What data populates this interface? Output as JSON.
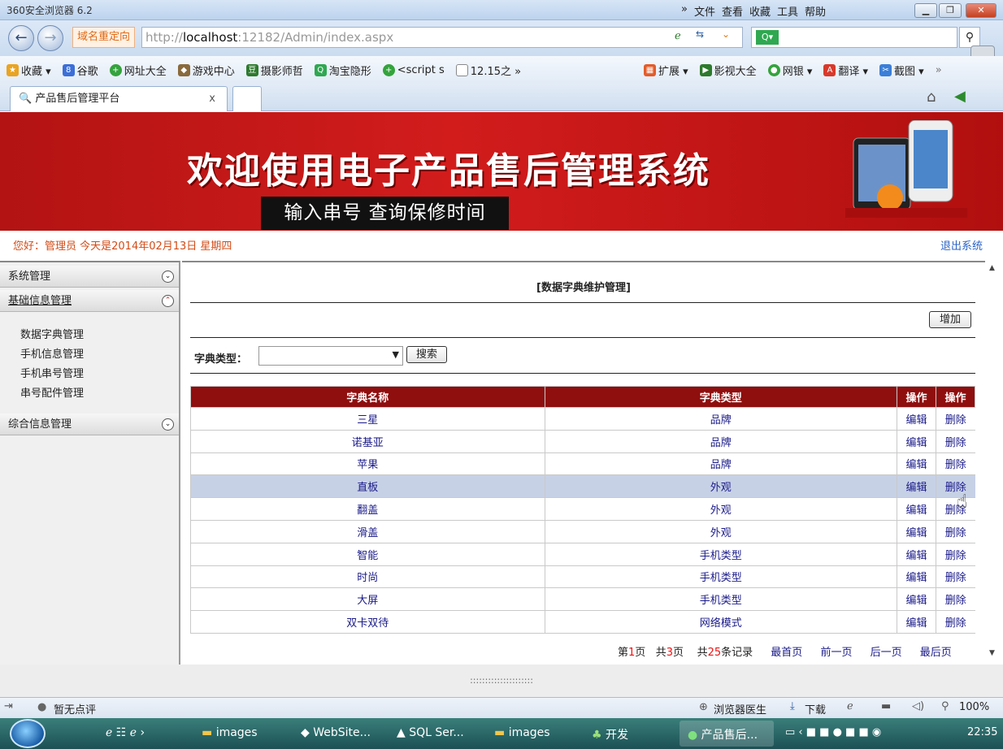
{
  "browser": {
    "app_title": "360安全浏览器 6.2",
    "menu": [
      "»",
      "文件",
      "查看",
      "收藏",
      "工具",
      "帮助"
    ],
    "redirect_label": "域名重定向",
    "url_prefix": "http://",
    "url_host": "localhost",
    "url_rest": ":12182/Admin/index.aspx",
    "bookmarks": [
      "收藏 ▾",
      "谷歌",
      "网址大全",
      "游戏中心",
      "摄影师哲",
      "淘宝隐形",
      "<script s",
      "12.15之 »"
    ],
    "bookmarks_right": [
      "扩展 ▾",
      "影视大全",
      "网银 ▾",
      "翻译 ▾",
      "截图 ▾",
      "»"
    ],
    "tab_title": "产品售后管理平台",
    "tab_close": "x"
  },
  "banner": {
    "title": "欢迎使用电子产品售后管理系统",
    "subtitle": "输入串号 查询保修时间"
  },
  "header": {
    "greeting": "您好：管理员   今天是2014年02月13日   星期四",
    "logout": "退出系统"
  },
  "sidebar": {
    "sections": [
      {
        "label": "系统管理"
      },
      {
        "label": "基础信息管理"
      },
      {
        "label": "综合信息管理"
      }
    ],
    "items": [
      "数据字典管理",
      "手机信息管理",
      "手机串号管理",
      "串号配件管理"
    ]
  },
  "main": {
    "title": "[数据字典维护管理]",
    "add_button": "增加",
    "filter_label": "字典类型：",
    "search_button": "搜索",
    "columns": [
      "字典名称",
      "字典类型",
      "操作",
      "操作"
    ],
    "rows": [
      {
        "name": "三星",
        "type": "品牌",
        "edit": "编辑",
        "del": "删除"
      },
      {
        "name": "诺基亚",
        "type": "品牌",
        "edit": "编辑",
        "del": "删除"
      },
      {
        "name": "苹果",
        "type": "品牌",
        "edit": "编辑",
        "del": "删除"
      },
      {
        "name": "直板",
        "type": "外观",
        "edit": "编辑",
        "del": "删除"
      },
      {
        "name": "翻盖",
        "type": "外观",
        "edit": "编辑",
        "del": "删除"
      },
      {
        "name": "滑盖",
        "type": "外观",
        "edit": "编辑",
        "del": "删除"
      },
      {
        "name": "智能",
        "type": "手机类型",
        "edit": "编辑",
        "del": "删除"
      },
      {
        "name": "时尚",
        "type": "手机类型",
        "edit": "编辑",
        "del": "删除"
      },
      {
        "name": "大屏",
        "type": "手机类型",
        "edit": "编辑",
        "del": "删除"
      },
      {
        "name": "双卡双待",
        "type": "网络模式",
        "edit": "编辑",
        "del": "删除"
      }
    ],
    "pager": {
      "page_pre": "第",
      "page": "1",
      "page_post": "页",
      "total_pre": "共",
      "total_pages": "3",
      "total_post": "页",
      "rec_pre": "共",
      "records": "25",
      "rec_post": "条记录",
      "first": "最首页",
      "prev": "前一页",
      "next": "后一页",
      "last": "最后页"
    }
  },
  "status": {
    "splitter": ":::::::::::::::::::::",
    "rating": "暂无点评",
    "doctor": "浏览器医生",
    "download": "下载",
    "zoom": "100%"
  },
  "taskbar": {
    "items": [
      "images",
      "WebSite...",
      "SQL Ser...",
      "images",
      "开发",
      "产品售后..."
    ],
    "time": "22:35"
  },
  "colors": {
    "banner": "#c41616",
    "grid_header": "#8f0e0e",
    "highlight_row": "#c7d1e6",
    "link": "#1a1a8a",
    "greeting": "#d34b16"
  }
}
